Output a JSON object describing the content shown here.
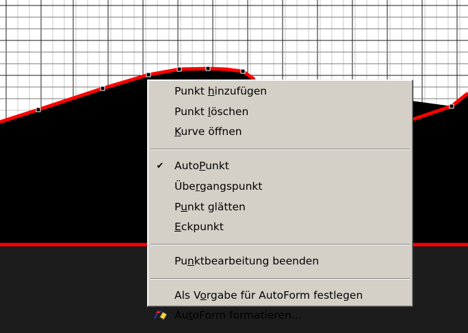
{
  "colors": {
    "grid_line": "#1a1a1a",
    "grid_background": "#ffffff",
    "shape_fill": "#000000",
    "shape_outline": "#ff0000",
    "lower_band": "#1c1c1c",
    "menu_background": "#d4d0c8"
  },
  "context_menu": {
    "items": [
      {
        "label": "Punkt hinzufügen",
        "accel": "h",
        "checked": false
      },
      {
        "label": "Punkt löschen",
        "accel": "l",
        "checked": false
      },
      {
        "label": "Kurve öffnen",
        "accel": "K",
        "checked": false
      },
      {
        "separator": true
      },
      {
        "label": "AutoPunkt",
        "accel": "P",
        "checked": true
      },
      {
        "label": "Übergangspunkt",
        "accel": "r",
        "checked": false
      },
      {
        "label": "Punkt glätten",
        "accel": "u",
        "checked": false
      },
      {
        "label": "Eckpunkt",
        "accel": "E",
        "checked": false
      },
      {
        "separator": true
      },
      {
        "label": "Punktbearbeitung beenden",
        "accel": "n",
        "checked": false
      },
      {
        "separator": true
      },
      {
        "label": "Als Vorgabe für AutoForm festlegen",
        "accel": "o",
        "checked": false
      },
      {
        "label": "AutoForm formatieren...",
        "accel": "t",
        "checked": false,
        "icon": "format-autoshape-icon"
      }
    ]
  }
}
